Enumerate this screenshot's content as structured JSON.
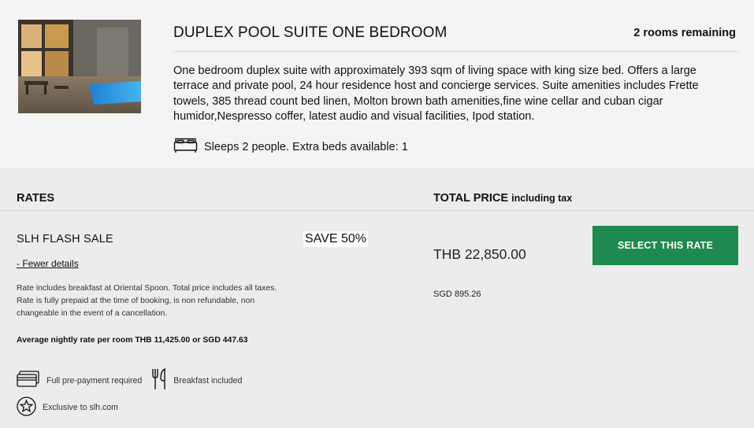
{
  "room": {
    "title": "DUPLEX POOL SUITE ONE BEDROOM",
    "rooms_remaining": "2 rooms remaining",
    "description": "One bedroom duplex suite with approximately 393 sqm of living space with king size bed. Offers a large terrace and private pool, 24 hour residence host and concierge services. Suite amenities includes Frette towels, 385 thread count bed linen, Molton brown bath amenities,fine wine cellar and cuban cigar humidor,Nespresso coffer, latest audio and visual facilities, Ipod station.",
    "sleeps": "Sleeps 2 people. Extra beds available: 1",
    "bed_icon": "bed-icon"
  },
  "rates": {
    "heading": "RATES",
    "total_heading": "TOTAL PRICE",
    "total_suffix": "including tax",
    "rate": {
      "name": "SLH FLASH SALE",
      "badge": "SAVE 50%",
      "details_link": "- Fewer details",
      "info": "Rate includes breakfast at Oriental Spoon. Total price includes all taxes. Rate is fully prepaid at the time of booking, is non refundable, non changeable in the event of a cancellation.",
      "average": "Average nightly rate per room THB 11,425.00 or SGD 447.63",
      "price_main": "THB 22,850.00",
      "price_secondary": "SGD 895.26",
      "select_label": "SELECT THIS RATE",
      "features": [
        {
          "icon": "credit-card-icon",
          "label": "Full pre-payment required"
        },
        {
          "icon": "fork-knife-icon",
          "label": "Breakfast included"
        },
        {
          "icon": "star-icon",
          "label": "Exclusive to slh.com"
        }
      ]
    }
  },
  "colors": {
    "select_button": "#1e8a4f",
    "room_bg": "#f4f4f4",
    "rates_bg": "#ececec"
  }
}
